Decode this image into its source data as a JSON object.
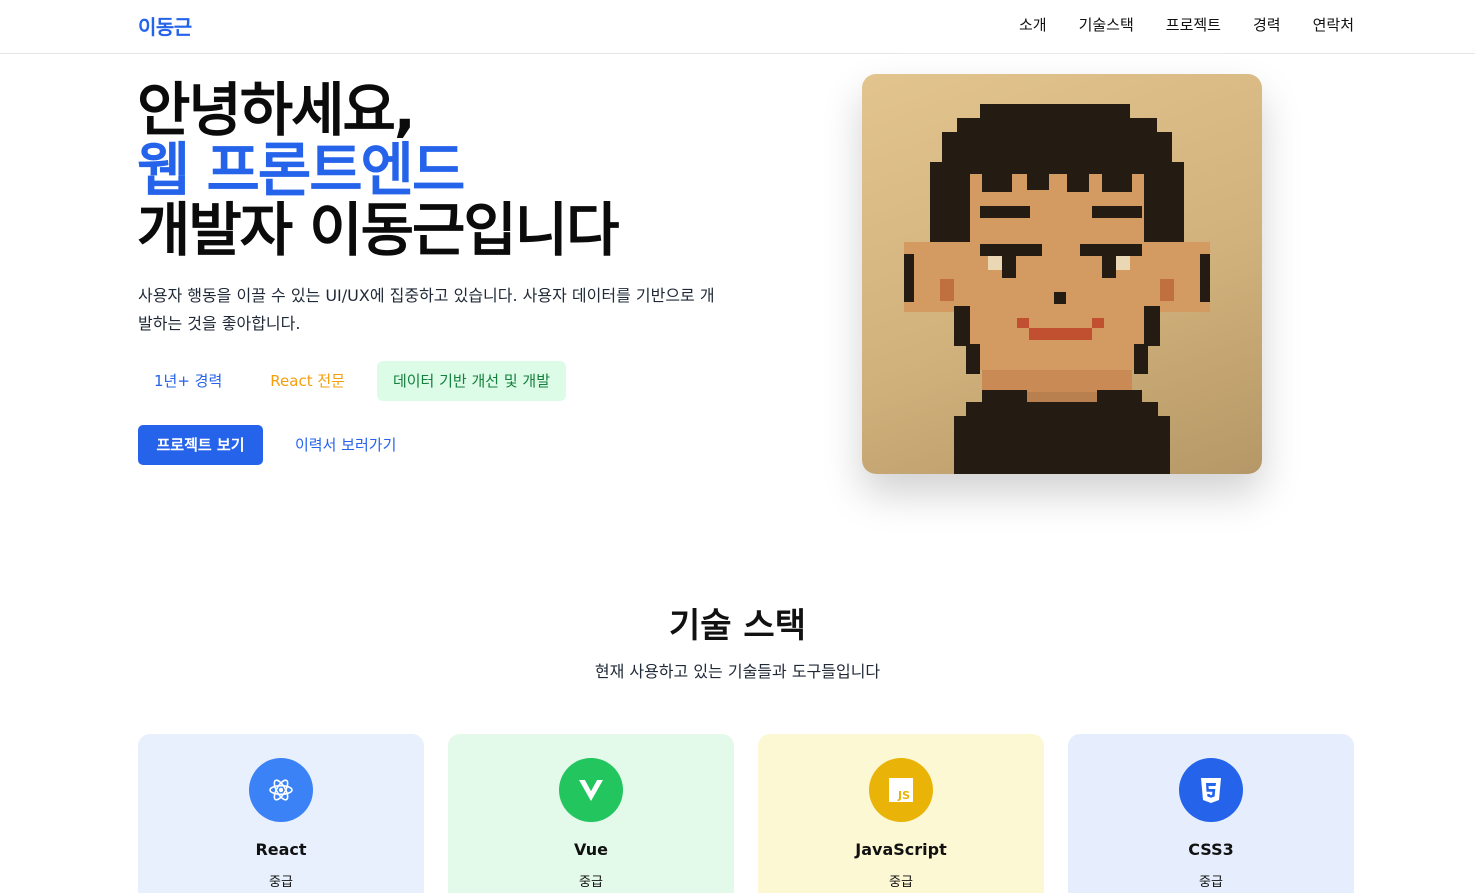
{
  "nav": {
    "brand": "이동근",
    "links": [
      "소개",
      "기술스택",
      "프로젝트",
      "경력",
      "연락처"
    ]
  },
  "hero": {
    "title_line1": "안녕하세요,",
    "title_line2": "웹 프론트엔드",
    "title_line3": "개발자 이동근입니다",
    "description": "사용자 행동을 이끌 수 있는 UI/UX에 집중하고 있습니다. 사용자 데이터를 기반으로 개발하는 것을 좋아합니다.",
    "tags": [
      "1년+ 경력",
      "React 전문",
      "데이터 기반 개선 및 개발"
    ],
    "primary_button": "프로젝트 보기",
    "secondary_link": "이력서 보러가기"
  },
  "skills": {
    "title": "기술 스택",
    "subtitle": "현재 사용하고 있는 기술들과 도구들입니다",
    "cards": [
      {
        "name": "React",
        "level": "중급",
        "icon": "react-icon",
        "icon_color": "#3b82f6",
        "bg_color": "#e8f0fe"
      },
      {
        "name": "Vue",
        "level": "중급",
        "icon": "vue-icon",
        "icon_color": "#22c55e",
        "bg_color": "#e3f9ea"
      },
      {
        "name": "JavaScript",
        "level": "중급",
        "icon": "javascript-icon",
        "icon_color": "#eab308",
        "bg_color": "#fdf8d4"
      },
      {
        "name": "CSS3",
        "level": "중급",
        "icon": "css3-icon",
        "icon_color": "#2563eb",
        "bg_color": "#e6eefd"
      }
    ]
  },
  "colors": {
    "accent": "#2563eb",
    "tag_orange": "#f59e0b",
    "tag_green_text": "#15803d",
    "tag_green_bg": "#dcfce7"
  }
}
